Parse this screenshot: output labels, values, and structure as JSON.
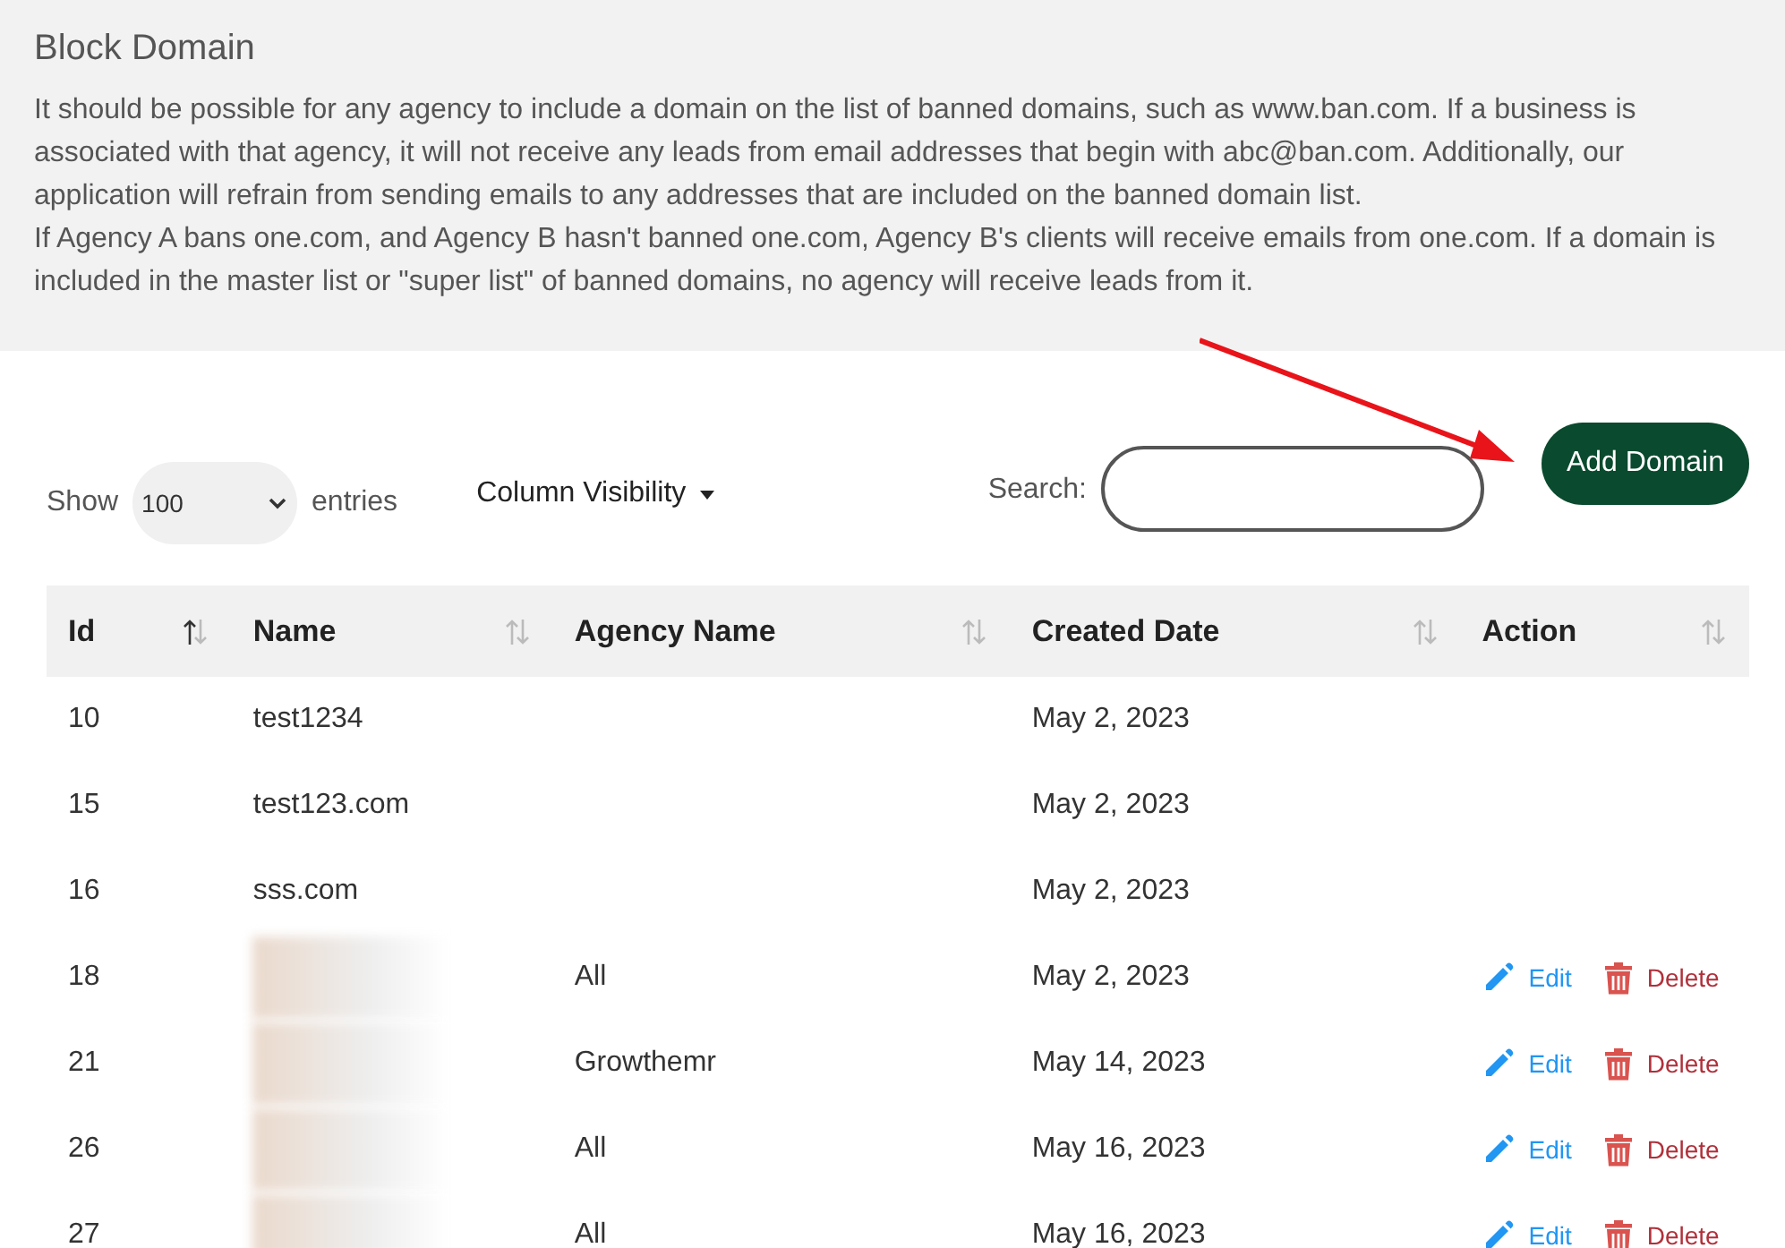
{
  "info_panel": {
    "title": "Block Domain",
    "paragraphs": [
      "It should be possible for any agency to include a domain on the list of banned domains, such as www.ban.com. If a business is associated with that agency, it will not receive any leads from email addresses that begin with abc@ban.com. Additionally, our application will refrain from sending emails to any addresses that are included on the banned domain list.",
      "If Agency A bans one.com, and Agency B hasn't banned one.com, Agency B's clients will receive emails from one.com. If a domain is included in the master list or \"super list\" of banned domains, no agency will receive leads from it."
    ]
  },
  "toolbar": {
    "show_label": "Show",
    "page_size": "100",
    "entries_label": "entries",
    "column_visibility": "Column Visibility",
    "search_label": "Search:",
    "add_button": "Add Domain"
  },
  "table": {
    "columns": [
      {
        "label": "Id",
        "sort_ascending": true
      },
      {
        "label": "Name",
        "sort_ascending": false
      },
      {
        "label": "Agency Name",
        "sort_ascending": false
      },
      {
        "label": "Created Date",
        "sort_ascending": false
      },
      {
        "label": "Action",
        "sort_ascending": false
      }
    ],
    "rows": [
      {
        "id": "10",
        "name": "test1234",
        "created": "May 2, 2023"
      },
      {
        "id": "15",
        "name": "test123.com",
        "created": "May 2, 2023"
      },
      {
        "id": "16",
        "name": "sss.com",
        "created": "May 2, 2023"
      },
      {
        "id": "18",
        "redacted": true,
        "agency": "All",
        "created": "May 2, 2023",
        "actions": [
          {
            "kind": "edit",
            "label": "Edit"
          },
          {
            "kind": "delete",
            "label": "Delete"
          }
        ]
      },
      {
        "id": "21",
        "redacted": true,
        "agency": "Growthemr",
        "created": "May 14, 2023",
        "actions": [
          {
            "kind": "edit",
            "label": "Edit"
          },
          {
            "kind": "delete",
            "label": "Delete"
          }
        ]
      },
      {
        "id": "26",
        "redacted": true,
        "agency": "All",
        "created": "May 16, 2023",
        "actions": [
          {
            "kind": "edit",
            "label": "Edit"
          },
          {
            "kind": "delete",
            "label": "Delete"
          }
        ]
      },
      {
        "id": "27",
        "redacted": true,
        "agency": "All",
        "created": "May 16, 2023",
        "actions": [
          {
            "kind": "edit",
            "label": "Edit"
          },
          {
            "kind": "delete",
            "label": "Delete"
          }
        ]
      }
    ]
  }
}
